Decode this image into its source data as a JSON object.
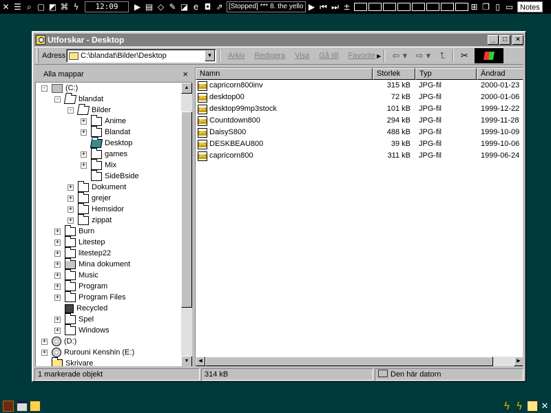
{
  "topbar": {
    "clock": "12:09",
    "now_playing": "[Stopped] *** 8. the yello",
    "notes_label": "Notes"
  },
  "window": {
    "title": "Utforskar - Desktop",
    "address_label": "Adress",
    "address_value": "C:\\blandat\\Bilder\\Desktop",
    "menu": [
      "Arkiv",
      "Redigera",
      "Visa",
      "Gå till",
      "Favorite"
    ]
  },
  "tree": {
    "header": "Alla mappar",
    "items": [
      {
        "label": "(C:)",
        "icon": "drive-icon"
      },
      {
        "label": "blandat",
        "icon": "folder-open-icon"
      },
      {
        "label": "Bilder",
        "icon": "folder-open-icon"
      },
      {
        "label": "Anime",
        "icon": "folder-icon"
      },
      {
        "label": "Blandat",
        "icon": "folder-icon"
      },
      {
        "label": "Desktop",
        "icon": "folder-selected-icon"
      },
      {
        "label": "games",
        "icon": "folder-icon"
      },
      {
        "label": "Mix",
        "icon": "folder-icon"
      },
      {
        "label": "SideBside",
        "icon": "folder-icon"
      },
      {
        "label": "Dokument",
        "icon": "folder-icon"
      },
      {
        "label": "grejer",
        "icon": "folder-icon"
      },
      {
        "label": "Hemsidor",
        "icon": "folder-icon"
      },
      {
        "label": "zippat",
        "icon": "folder-icon"
      },
      {
        "label": "Burn",
        "icon": "folder-icon"
      },
      {
        "label": "Litestep",
        "icon": "folder-icon"
      },
      {
        "label": "litestep22",
        "icon": "folder-icon"
      },
      {
        "label": "Mina dokument",
        "icon": "documents-folder-icon"
      },
      {
        "label": "Music",
        "icon": "folder-icon"
      },
      {
        "label": "Program",
        "icon": "folder-icon"
      },
      {
        "label": "Program Files",
        "icon": "folder-icon"
      },
      {
        "label": "Recycled",
        "icon": "recycle-bin-icon"
      },
      {
        "label": "Spel",
        "icon": "folder-icon"
      },
      {
        "label": "Windows",
        "icon": "folder-icon"
      },
      {
        "label": "(D:)",
        "icon": "cd-drive-icon"
      },
      {
        "label": "Rurouni Kenshin (E:)",
        "icon": "cd-drive-icon"
      },
      {
        "label": "Skrivare",
        "icon": "printers-folder-icon"
      }
    ]
  },
  "files": {
    "columns": [
      "Namn",
      "Storlek",
      "Typ",
      "Ändrad"
    ],
    "rows": [
      {
        "name": "capricorn800inv",
        "size": "315 kB",
        "type": "JPG-fil",
        "modified": "2000-01-23"
      },
      {
        "name": "desktop00",
        "size": "72 kB",
        "type": "JPG-fil",
        "modified": "2000-01-06"
      },
      {
        "name": "desktop99mp3stock",
        "size": "101 kB",
        "type": "JPG-fil",
        "modified": "1999-12-22"
      },
      {
        "name": "Countdown800",
        "size": "294 kB",
        "type": "JPG-fil",
        "modified": "1999-11-28"
      },
      {
        "name": "DaisyS800",
        "size": "488 kB",
        "type": "JPG-fil",
        "modified": "1999-10-09"
      },
      {
        "name": "DESKBEAU800",
        "size": "39 kB",
        "type": "JPG-fil",
        "modified": "1999-10-06"
      },
      {
        "name": "capricorn800",
        "size": "311 kB",
        "type": "JPG-fil",
        "modified": "1999-06-24"
      }
    ]
  },
  "status": {
    "selected": "1 markerade objekt",
    "size": "314 kB",
    "location": "Den här datorn"
  }
}
